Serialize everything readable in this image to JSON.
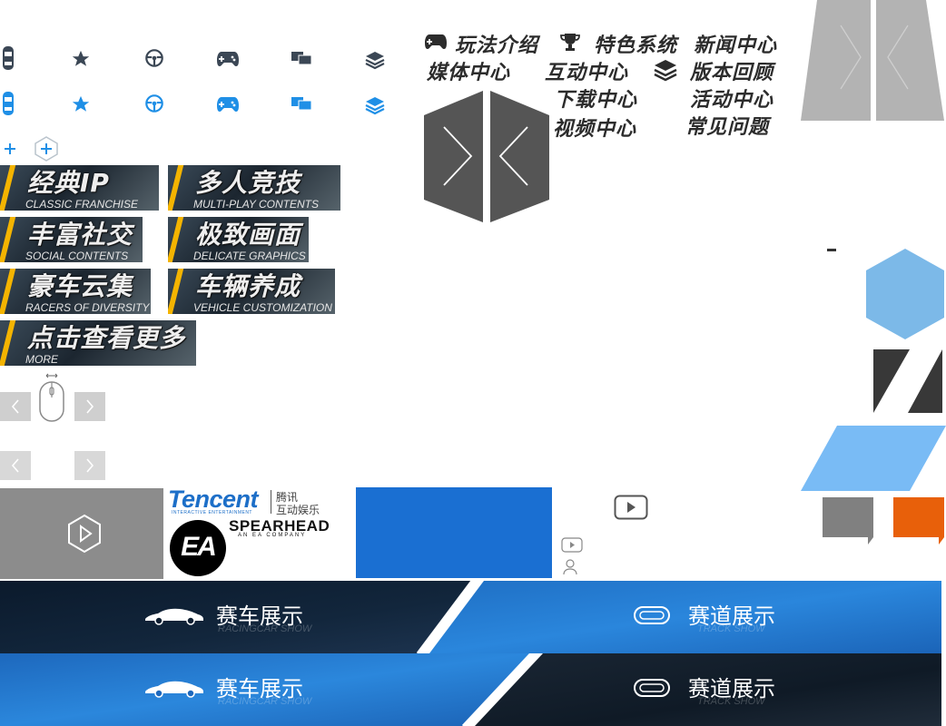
{
  "sprite_icons": {
    "row1": [
      "car-topview-icon",
      "star-icon",
      "steering-wheel-icon",
      "gamepad-icon",
      "chat-icon",
      "layers-icon"
    ],
    "row2": [
      "car-topview-icon",
      "star-icon",
      "steering-wheel-icon",
      "gamepad-icon",
      "chat-icon",
      "layers-icon"
    ],
    "row1_color": "#3b4755",
    "row2_color": "#1f8fe6"
  },
  "nav": {
    "gameplay": "玩法介绍",
    "features": "特色系统",
    "news": "新闻中心",
    "media": "媒体中心",
    "interactive": "互动中心",
    "versions": "版本回顾",
    "download": "下载中心",
    "events": "活动中心",
    "videos": "视频中心",
    "faq": "常见问题"
  },
  "tiles": [
    {
      "cn": "经典IP",
      "en": "CLASSIC FRANCHISE"
    },
    {
      "cn": "多人竞技",
      "en": "MULTI-PLAY CONTENTS"
    },
    {
      "cn": "丰富社交",
      "en": "SOCIAL CONTENTS"
    },
    {
      "cn": "极致画面",
      "en": "DELICATE GRAPHICS"
    },
    {
      "cn": "豪车云集",
      "en": "RACERS OF DIVERSITY"
    },
    {
      "cn": "车辆养成",
      "en": "VEHICLE CUSTOMIZATION"
    },
    {
      "cn": "点击查看更多",
      "en": "MORE"
    }
  ],
  "logos": {
    "tencent": "Tencent",
    "tencent_sub": "INTERACTIVE ENTERTAINMENT",
    "tencent_cn1": "腾讯",
    "tencent_cn2": "互动娱乐",
    "ea": "EA",
    "spearhead": "SPEARHEAD",
    "spearhead_sub": "AN EA COMPANY"
  },
  "showcase": {
    "car_cn": "赛车展示",
    "car_en": "RACINGCAR SHOW",
    "track_cn": "赛道展示",
    "track_en": "TRACK SHOW"
  },
  "colors": {
    "accent_blue": "#1f8fe6",
    "brand_blue_block": "#1a6fd2",
    "hex_light_blue": "#7cb9e8",
    "para_blue": "#79bbf5",
    "dark_shape": "#383838",
    "orange": "#e8600a",
    "stripe_yellow": "#f4b400"
  }
}
